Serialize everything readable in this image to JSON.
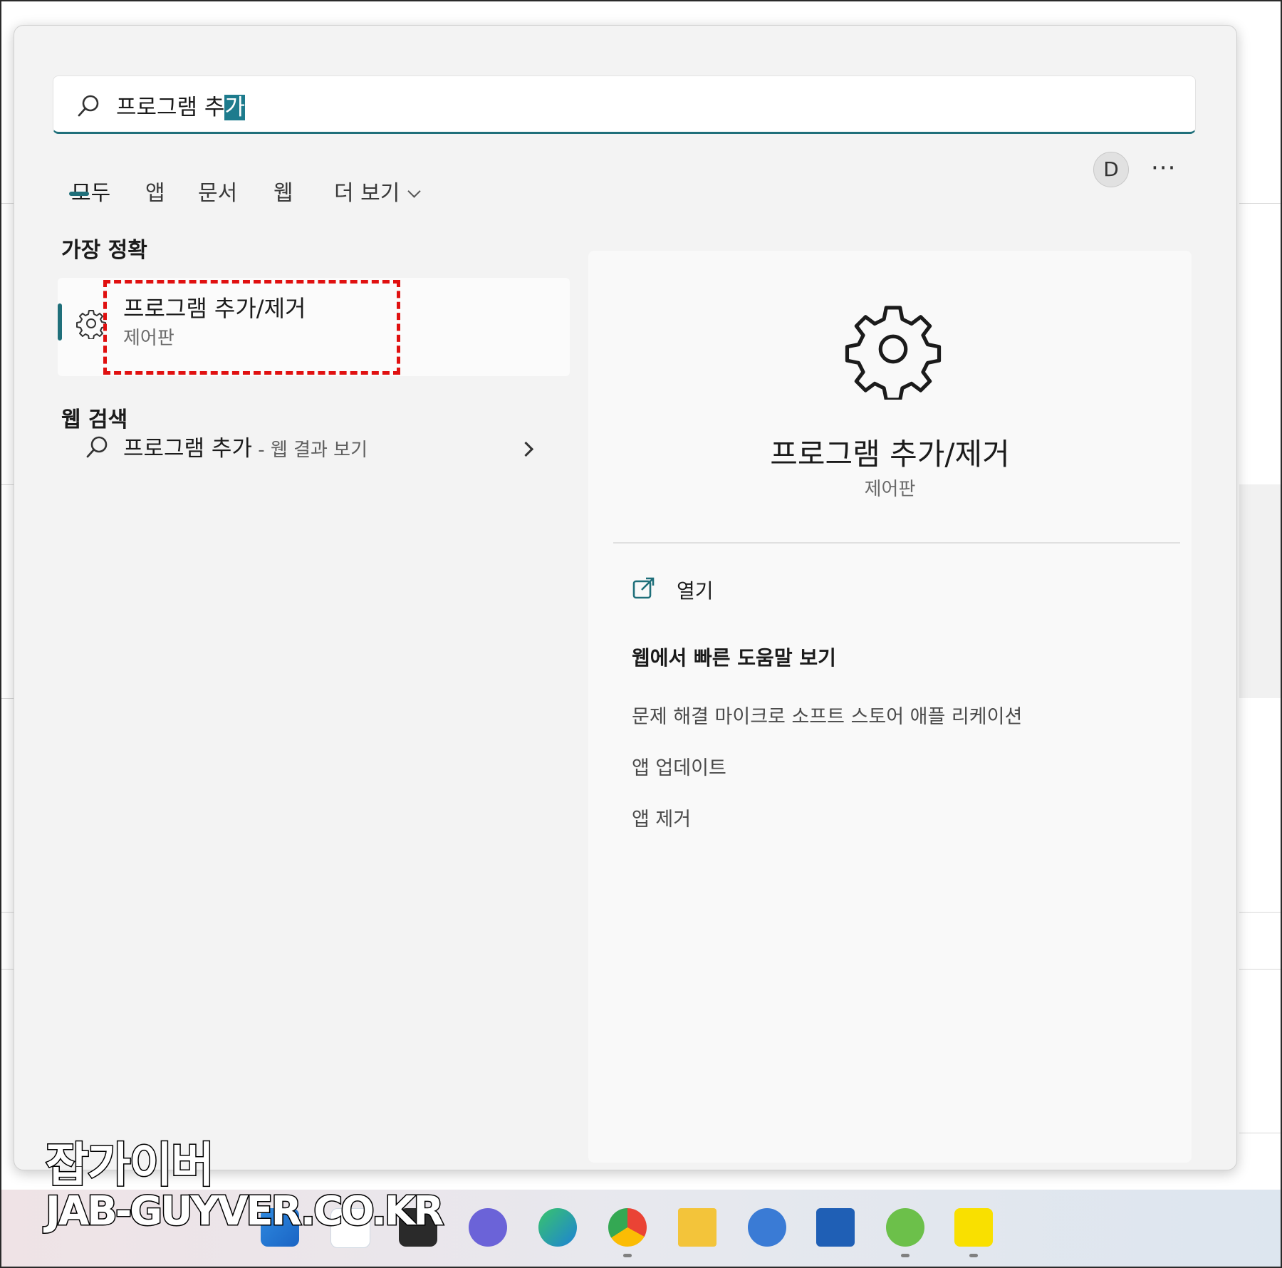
{
  "search": {
    "query_prefix": "프로그램 추",
    "query_selected": "가"
  },
  "tabs": [
    {
      "label": "모두",
      "active": true
    },
    {
      "label": "앱"
    },
    {
      "label": "문서"
    },
    {
      "label": "웹"
    },
    {
      "label": "더 보기"
    }
  ],
  "header": {
    "avatar_letter": "D",
    "more_label": "···"
  },
  "best_match": {
    "section_title": "가장 정확",
    "title": "프로그램 추가/제거",
    "subtitle": "제어판",
    "icon": "gear-icon"
  },
  "web_search": {
    "section_title": "웹 검색",
    "query": "프로그램 추가",
    "suffix": " - 웹 결과 보기"
  },
  "detail": {
    "title": "프로그램 추가/제거",
    "subtitle": "제어판",
    "open_label": "열기",
    "help_heading": "웹에서 빠른 도움말 보기",
    "help_links": [
      "문제 해결 마이크로 소프트 스토어 애플 리케이션",
      "앱 업데이트",
      "앱 제거"
    ]
  },
  "watermark": {
    "line1": "잡가이버",
    "line2": "JAB-GUYVER.CO.KR"
  },
  "taskbar": {
    "icons": [
      "windows-start-icon",
      "search-icon",
      "task-view-icon",
      "teams-chat-icon",
      "edge-icon",
      "chrome-icon",
      "file-explorer-icon",
      "cortana-icon",
      "microsoft-store-icon",
      "utorrent-icon",
      "kakaotalk-icon"
    ]
  },
  "colors": {
    "accent": "#1f6f7a",
    "highlight_box": "#e01010",
    "selection": "#1d7b8d"
  }
}
